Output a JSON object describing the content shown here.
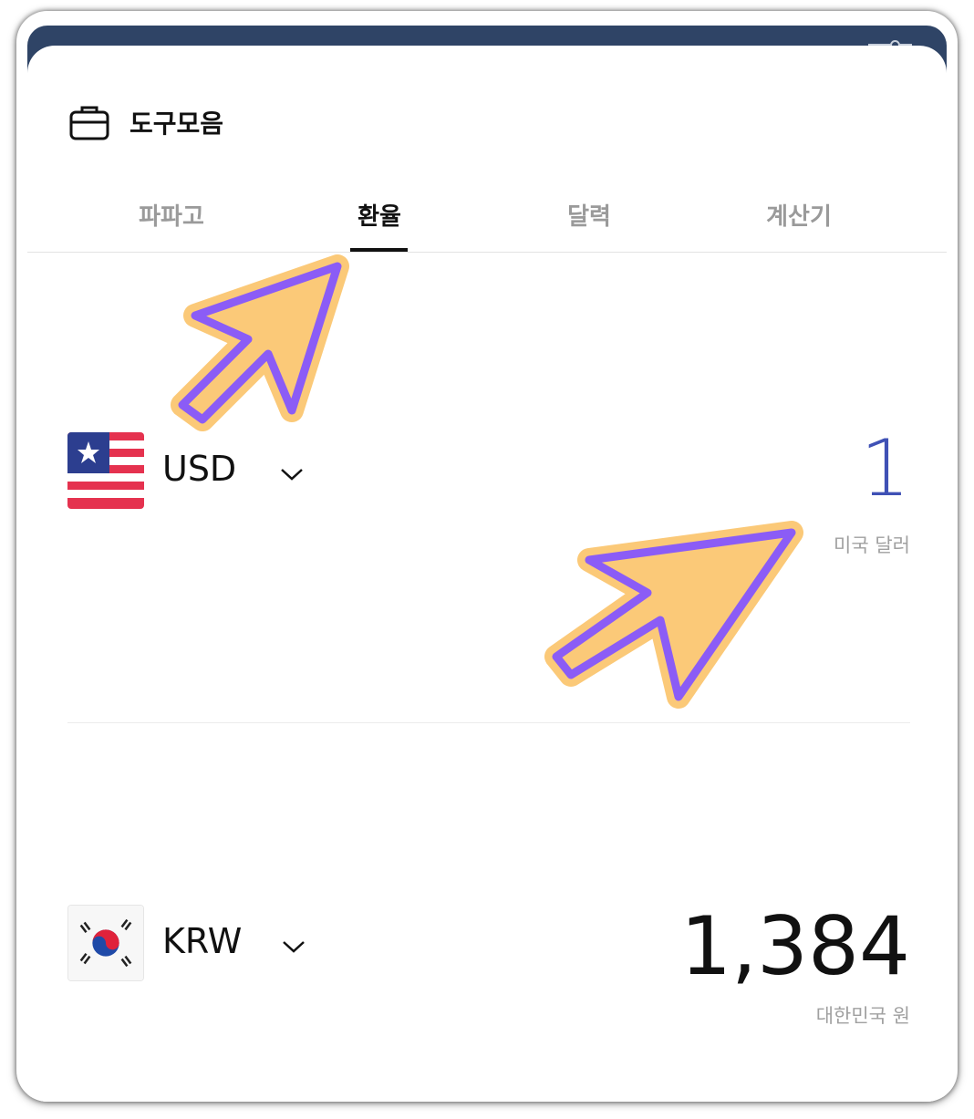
{
  "header": {
    "title": "도구모음",
    "icon": "briefcase-icon"
  },
  "tabs": [
    {
      "label": "파파고",
      "active": false
    },
    {
      "label": "환율",
      "active": true
    },
    {
      "label": "달력",
      "active": false
    },
    {
      "label": "계산기",
      "active": false
    }
  ],
  "from_currency": {
    "code": "USD",
    "amount": "1",
    "name": "미국 달러",
    "flag": "us-flag-icon",
    "amount_color": "#3f51b5"
  },
  "to_currency": {
    "code": "KRW",
    "amount": "1,384",
    "name": "대한민국 원",
    "flag": "kr-flag-icon"
  },
  "colors": {
    "topbar": "#2f4466",
    "arrow_fill": "#fbc978",
    "arrow_stroke": "#8b5cf6"
  }
}
